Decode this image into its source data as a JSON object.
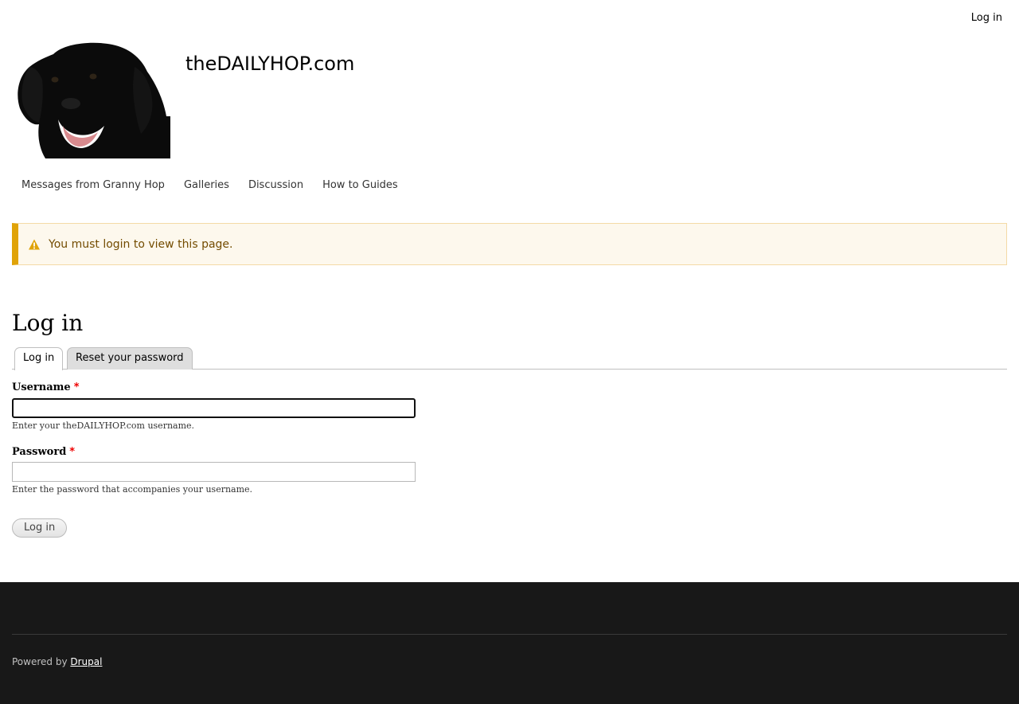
{
  "header": {
    "secondary_menu": {
      "login_label": "Log in"
    },
    "site_name": "theDAILYHOP.com"
  },
  "main_nav": {
    "items": [
      {
        "label": "Messages from Granny Hop"
      },
      {
        "label": "Galleries"
      },
      {
        "label": "Discussion"
      },
      {
        "label": "How to Guides"
      }
    ]
  },
  "alert": {
    "icon": "warning-icon",
    "message": "You must login to view this page.",
    "colors": {
      "accent": "#e0a308",
      "background": "#fdf8ed",
      "text": "#734c00"
    }
  },
  "page": {
    "title": "Log in",
    "tabs": [
      {
        "label": "Log in",
        "active": true
      },
      {
        "label": "Reset your password",
        "active": false
      }
    ]
  },
  "form": {
    "username": {
      "label": "Username",
      "required_marker": "*",
      "value": "",
      "description": "Enter your theDAILYHOP.com username."
    },
    "password": {
      "label": "Password",
      "required_marker": "*",
      "value": "",
      "description": "Enter the password that accompanies your username."
    },
    "submit_label": "Log in"
  },
  "footer": {
    "powered_by_prefix": "Powered by ",
    "powered_by_link": "Drupal",
    "colors": {
      "background": "#181818"
    }
  }
}
